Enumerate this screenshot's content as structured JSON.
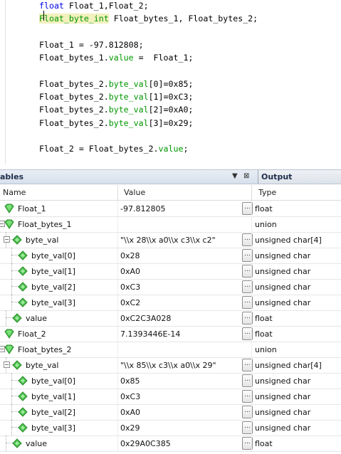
{
  "editor": {
    "lines": [
      {
        "parts": [
          {
            "t": "float",
            "c": "kw"
          },
          {
            "t": " Float_1,Float_2;",
            "c": ""
          }
        ]
      },
      {
        "parts": [
          {
            "t": "Float_byte_int",
            "c": "typehl"
          },
          {
            "t": " Float_bytes_1, Float_bytes_2;",
            "c": ""
          }
        ]
      },
      {
        "parts": []
      },
      {
        "parts": [
          {
            "t": "Float_1 = -97.812808;",
            "c": ""
          }
        ]
      },
      {
        "parts": [
          {
            "t": "Float_bytes_1.",
            "c": ""
          },
          {
            "t": "value",
            "c": "fld"
          },
          {
            "t": " =  Float_1;",
            "c": ""
          }
        ]
      },
      {
        "parts": []
      },
      {
        "parts": [
          {
            "t": "Float_bytes_2.",
            "c": ""
          },
          {
            "t": "byte_val",
            "c": "fld"
          },
          {
            "t": "[0]=0x85;",
            "c": ""
          }
        ]
      },
      {
        "parts": [
          {
            "t": "Float_bytes_2.",
            "c": ""
          },
          {
            "t": "byte_val",
            "c": "fld"
          },
          {
            "t": "[1]=0xC3;",
            "c": ""
          }
        ]
      },
      {
        "parts": [
          {
            "t": "Float_bytes_2.",
            "c": ""
          },
          {
            "t": "byte_val",
            "c": "fld"
          },
          {
            "t": "[2]=0xA0;",
            "c": ""
          }
        ]
      },
      {
        "parts": [
          {
            "t": "Float_bytes_2.",
            "c": ""
          },
          {
            "t": "byte_val",
            "c": "fld"
          },
          {
            "t": "[3]=0x29;",
            "c": ""
          }
        ]
      },
      {
        "parts": []
      },
      {
        "parts": [
          {
            "t": "Float_2 = Float_bytes_2.",
            "c": ""
          },
          {
            "t": "value",
            "c": "fld"
          },
          {
            "t": ";",
            "c": ""
          }
        ]
      }
    ]
  },
  "variables_panel": {
    "title": "ables",
    "output_title": "Output",
    "columns": {
      "name": "Name",
      "value": "Value",
      "type": "Type"
    },
    "rows": [
      {
        "name": "Float_1",
        "value": "-97.812805",
        "type": "float",
        "level": 0,
        "icon": "variable-icon",
        "expander": "",
        "has_dots": true
      },
      {
        "name": "Float_bytes_1",
        "value": "",
        "type": "union",
        "level": 0,
        "icon": "variable-icon",
        "expander": "minus",
        "has_dots": false
      },
      {
        "name": "byte_val",
        "value": "\"\\\\x 28\\\\x a0\\\\x c3\\\\x c2\"",
        "type": "unsigned char[4]",
        "level": 1,
        "icon": "field-icon",
        "expander": "minus",
        "has_dots": true
      },
      {
        "name": "byte_val[0]",
        "value": "0x28",
        "type": "unsigned char",
        "level": 2,
        "icon": "field-icon",
        "expander": "",
        "has_dots": true
      },
      {
        "name": "byte_val[1]",
        "value": "0xA0",
        "type": "unsigned char",
        "level": 2,
        "icon": "field-icon",
        "expander": "",
        "has_dots": true
      },
      {
        "name": "byte_val[2]",
        "value": "0xC3",
        "type": "unsigned char",
        "level": 2,
        "icon": "field-icon",
        "expander": "",
        "has_dots": true
      },
      {
        "name": "byte_val[3]",
        "value": "0xC2",
        "type": "unsigned char",
        "level": 2,
        "icon": "field-icon",
        "expander": "",
        "has_dots": true
      },
      {
        "name": "value",
        "value": "0xC2C3A028",
        "type": "float",
        "level": 1,
        "icon": "field-icon",
        "expander": "",
        "has_dots": true
      },
      {
        "name": "Float_2",
        "value": "7.1393446E-14",
        "type": "float",
        "level": 0,
        "icon": "variable-icon",
        "expander": "",
        "has_dots": true
      },
      {
        "name": "Float_bytes_2",
        "value": "",
        "type": "union",
        "level": 0,
        "icon": "variable-icon",
        "expander": "minus",
        "has_dots": false
      },
      {
        "name": "byte_val",
        "value": "\"\\\\x 85\\\\x c3\\\\x a0\\\\x 29\"",
        "type": "unsigned char[4]",
        "level": 1,
        "icon": "field-icon",
        "expander": "minus",
        "has_dots": true
      },
      {
        "name": "byte_val[0]",
        "value": "0x85",
        "type": "unsigned char",
        "level": 2,
        "icon": "field-icon",
        "expander": "",
        "has_dots": true
      },
      {
        "name": "byte_val[1]",
        "value": "0xC3",
        "type": "unsigned char",
        "level": 2,
        "icon": "field-icon",
        "expander": "",
        "has_dots": true
      },
      {
        "name": "byte_val[2]",
        "value": "0xA0",
        "type": "unsigned char",
        "level": 2,
        "icon": "field-icon",
        "expander": "",
        "has_dots": true
      },
      {
        "name": "byte_val[3]",
        "value": "0x29",
        "type": "unsigned char",
        "level": 2,
        "icon": "field-icon",
        "expander": "",
        "has_dots": true
      },
      {
        "name": "value",
        "value": "0x29A0C385",
        "type": "float",
        "level": 1,
        "icon": "field-icon",
        "expander": "",
        "has_dots": true
      }
    ],
    "dots_label": "...",
    "controls": {
      "dropdown": "▼",
      "close": "⊠"
    }
  },
  "colors": {
    "keyword": "#0000e6",
    "field": "#009600",
    "highlight": "#f3f1bd",
    "variable_icon": "#3cb83c"
  }
}
